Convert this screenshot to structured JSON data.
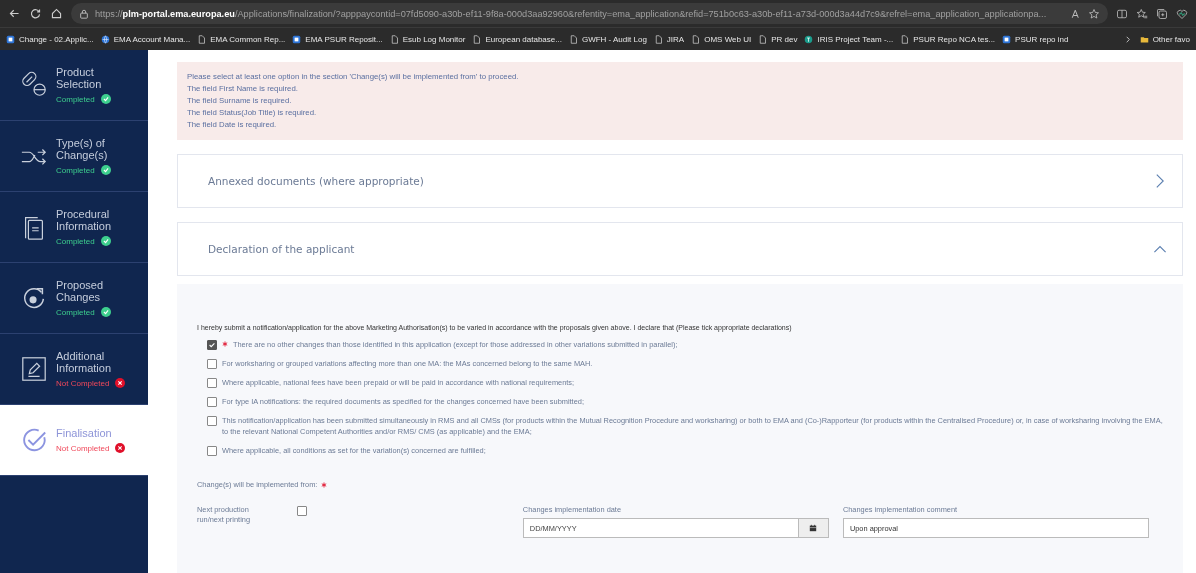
{
  "browser": {
    "url": {
      "scheme": "https://",
      "host": "plm-portal.ema.europa.eu",
      "path": "/Applications/finalization/?apppaycontid=07fd5090-a30b-ef11-9f8a-000d3aa92960&refentity=ema_application&refid=751b0c63-a30b-ef11-a73d-000d3a44d7c9&refrel=ema_application_applicationpa..."
    },
    "bookmarks": [
      {
        "label": "Change - 02.Applic...",
        "kind": "app"
      },
      {
        "label": "EMA Account Mana...",
        "kind": "globe"
      },
      {
        "label": "EMA Common Rep...",
        "kind": "page"
      },
      {
        "label": "EMA PSUR Reposit...",
        "kind": "app"
      },
      {
        "label": "Esub Log Monitor",
        "kind": "page"
      },
      {
        "label": "European database...",
        "kind": "page"
      },
      {
        "label": "GWFH - Audit Log",
        "kind": "page"
      },
      {
        "label": "JIRA",
        "kind": "page"
      },
      {
        "label": "OMS Web UI",
        "kind": "page"
      },
      {
        "label": "PR dev",
        "kind": "page"
      },
      {
        "label": "IRIS Project Team -...",
        "kind": "teams"
      },
      {
        "label": "PSUR Repo NCA tes...",
        "kind": "page"
      },
      {
        "label": "PSUR repo ind",
        "kind": "app"
      }
    ],
    "other_favorites": "Other favo"
  },
  "steps": [
    {
      "title": "Product Selection",
      "status": "Completed",
      "completed": true,
      "selected": false
    },
    {
      "title": "Type(s) of Change(s)",
      "status": "Completed",
      "completed": true,
      "selected": false
    },
    {
      "title": "Procedural Information",
      "status": "Completed",
      "completed": true,
      "selected": false
    },
    {
      "title": "Proposed Changes",
      "status": "Completed",
      "completed": true,
      "selected": false
    },
    {
      "title": "Additional Information",
      "status": "Not Completed",
      "completed": false,
      "selected": false
    },
    {
      "title": "Finalisation",
      "status": "Not Completed",
      "completed": false,
      "selected": true
    }
  ],
  "errors": [
    "Please select at least one option in the section 'Change(s) will be implemented from' to proceed.",
    "The field First Name is required.",
    "The field Surname is required.",
    "The field Status(Job Title) is required.",
    "The field Date is required."
  ],
  "sections": [
    {
      "title": "Annexed documents (where appropriate)",
      "expanded": false
    },
    {
      "title": "Declaration of the applicant",
      "expanded": true
    }
  ],
  "declaration": {
    "intro": "I hereby submit a notification/application for the above Marketing Authorisation(s) to be varied in accordance with the proposals given above. I declare that (Please tick appropriate declarations)",
    "items": [
      {
        "text": "There are no other changes than those identified in this application (except for those addressed in other variations submitted in parallel);",
        "checked": true,
        "required": true
      },
      {
        "text": "For worksharing or grouped variations affecting more than one MA: the MAs concerned belong to the same MAH.",
        "checked": false,
        "required": false
      },
      {
        "text": "Where applicable, national fees have been prepaid or will be paid in accordance with national requirements;",
        "checked": false,
        "required": false
      },
      {
        "text": "For type IA notifications: the required documents as specified for the changes concerned have been submitted;",
        "checked": false,
        "required": false
      },
      {
        "text": "This notification/application has been submitted simultaneously in RMS and all CMSs (for products within the Mutual Recognition Procedure and worksharing) or both to EMA and (Co-)Rapporteur (for products within the Centralised Procedure) or, in case of worksharing involving the EMA, to the relevant National Competent Authorities and/or RMS/ CMS (as applicable) and the EMA;",
        "checked": false,
        "required": false
      },
      {
        "text": "Where applicable, all conditions as set for the variation(s) concerned are fulfilled;",
        "checked": false,
        "required": false
      }
    ]
  },
  "implementation": {
    "label": "Change(s) will be implemented from:",
    "required": true,
    "next_production": {
      "label": "Next production run/next printing",
      "checked": false
    },
    "date": {
      "label": "Changes implementation date",
      "placeholder": "DD/MM/YYYY"
    },
    "comment": {
      "label": "Changes implementation comment",
      "value": "Upon approval"
    }
  }
}
